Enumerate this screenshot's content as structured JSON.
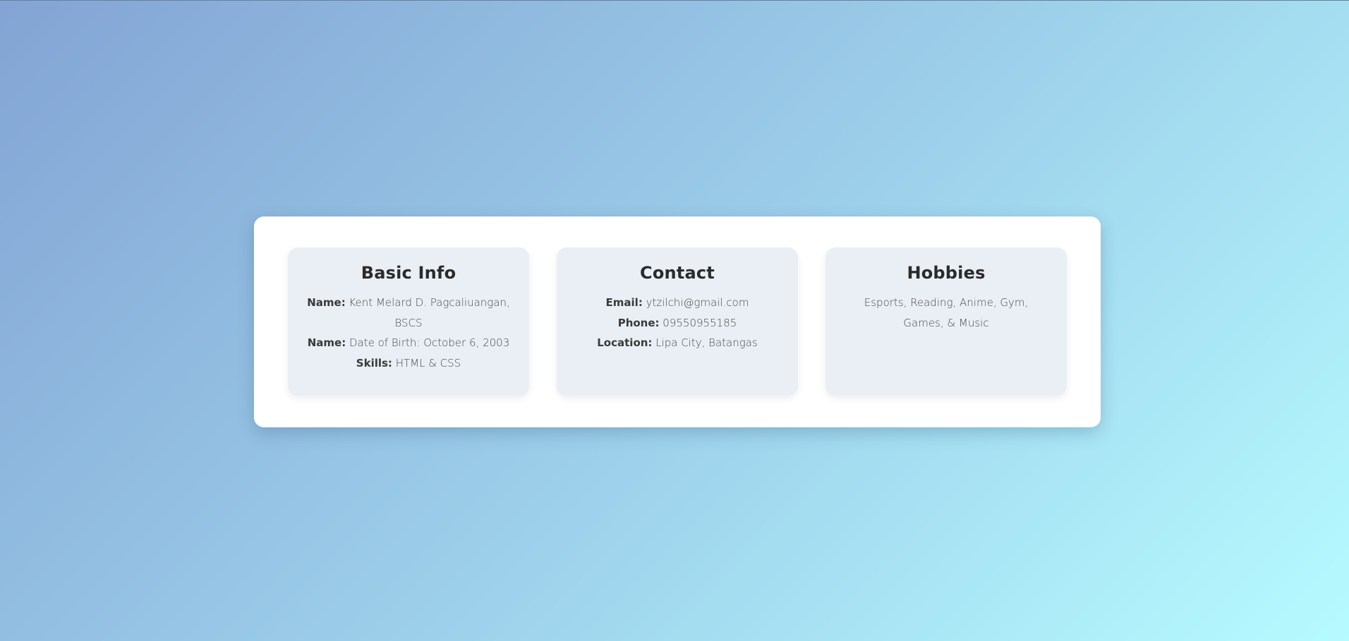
{
  "cards": [
    {
      "title": "Basic Info",
      "lines": [
        {
          "label": "Name:",
          "value": " Kent Melard D. Pagcaliuangan, BSCS"
        },
        {
          "label": "Name:",
          "value": " Date of Birth: October 6, 2003"
        },
        {
          "label": "Skills:",
          "value": " HTML & CSS"
        }
      ]
    },
    {
      "title": "Contact",
      "lines": [
        {
          "label": "Email:",
          "value": " ytzilchi@gmail.com"
        },
        {
          "label": "Phone:",
          "value": " 09550955185"
        },
        {
          "label": "Location:",
          "value": " Lipa City, Batangas"
        }
      ]
    },
    {
      "title": "Hobbies",
      "text": "Esports, Reading, Anime, Gym, Games, & Music"
    }
  ],
  "colors": {
    "gradient_start": "#83a4d4",
    "gradient_end": "#b6fbff",
    "container_bg": "#ffffff",
    "card_bg": "#e9eff5",
    "title": "#2b2b2b"
  }
}
